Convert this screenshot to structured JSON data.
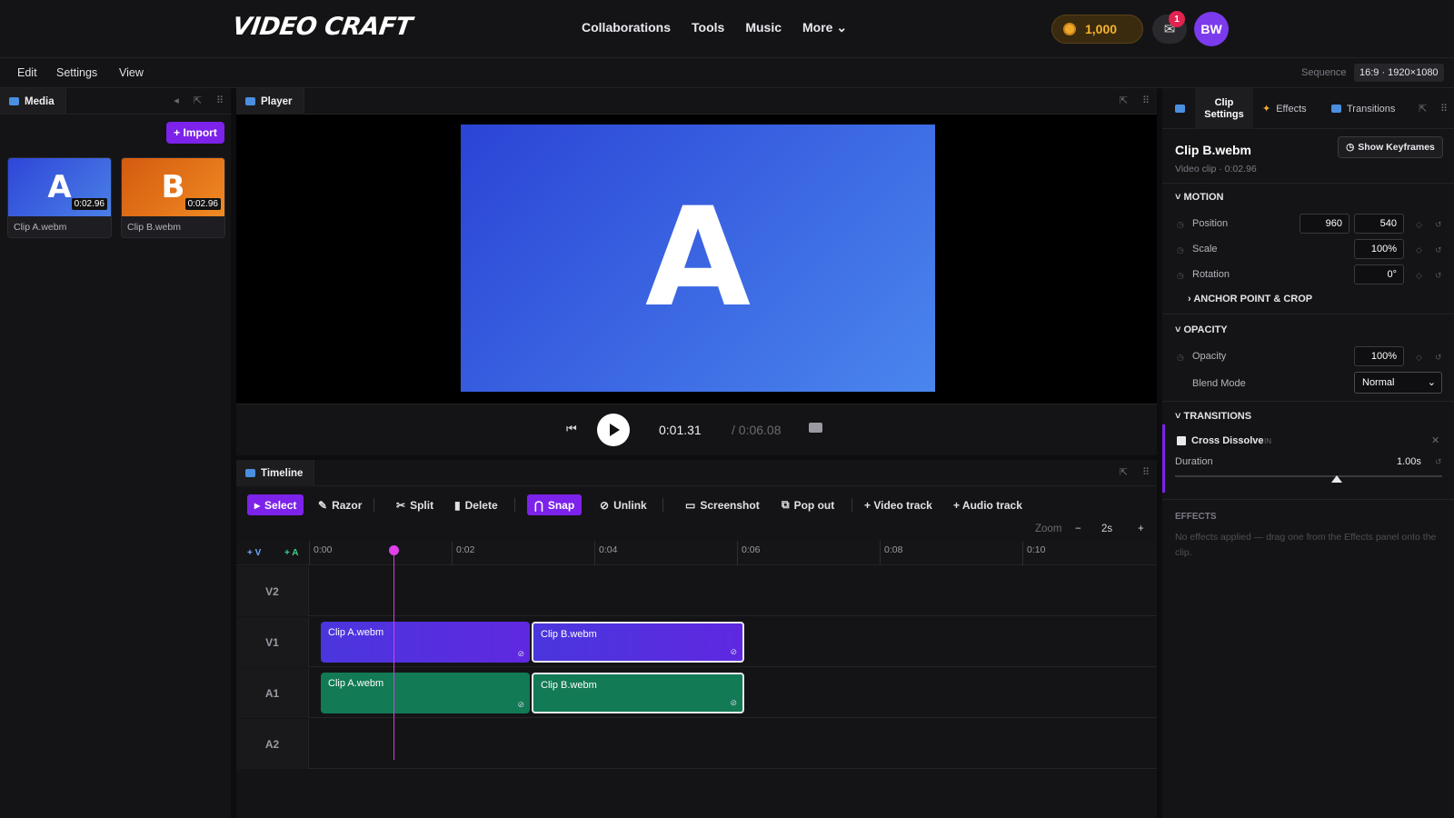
{
  "app": {
    "logo": "VIDEO CRAFT"
  },
  "nav": {
    "links": [
      "Collaborations",
      "Tools",
      "Music",
      "More ⌄"
    ]
  },
  "account": {
    "coins": "1,000",
    "inbox_badge": "1",
    "avatar": "BW"
  },
  "menubar": {
    "items": [
      "Edit",
      "Settings",
      "View"
    ],
    "sequence_label": "Sequence",
    "sequence_value": "16:9 · 1920×1080"
  },
  "media": {
    "title": "Media",
    "import_label": "+ Import",
    "clips": [
      {
        "letter": "A",
        "duration": "0:02.96",
        "name": "Clip A.webm"
      },
      {
        "letter": "B",
        "duration": "0:02.96",
        "name": "Clip B.webm"
      }
    ]
  },
  "player": {
    "title": "Player",
    "frame_letter": "A",
    "current_time": "0:01.31",
    "total_time": "/ 0:06.08"
  },
  "timeline": {
    "title": "Timeline",
    "tools": {
      "select": "Select",
      "razor": "Razor",
      "split": "Split",
      "delete": "Delete",
      "snap": "Snap",
      "unlink": "Unlink",
      "screenshot": "Screenshot",
      "popout": "Pop out",
      "video_track": "+ Video track",
      "audio_track": "+ Audio track"
    },
    "zoom": {
      "label": "Zoom",
      "minus": "−",
      "value": "2s",
      "plus": "+"
    },
    "add_v": "+ V",
    "add_a": "+ A",
    "ticks": [
      "0:00",
      "0:02",
      "0:04",
      "0:06",
      "0:08",
      "0:10"
    ],
    "tracks": [
      "V2",
      "V1",
      "A1",
      "A2"
    ],
    "clips": {
      "v1a": "Clip A.webm",
      "v1b": "Clip B.webm",
      "a1a": "Clip A.webm",
      "a1b": "Clip B.webm"
    }
  },
  "inspector": {
    "tabs": {
      "clip_settings_1": "Clip",
      "clip_settings_2": "Settings",
      "effects": "Effects",
      "transitions": "Transitions"
    },
    "clip_name": "Clip B.webm",
    "clip_meta": "Video clip · 0:02.96",
    "show_keyframes": "Show Keyframes",
    "motion": {
      "title": "MOTION",
      "position": "Position",
      "pos_x": "960",
      "pos_y": "540",
      "scale": "Scale",
      "scale_val": "100%",
      "rotation": "Rotation",
      "rotation_val": "0°",
      "anchor": "ANCHOR POINT & CROP"
    },
    "opacity": {
      "title": "OPACITY",
      "opacity": "Opacity",
      "opacity_val": "100%",
      "blend": "Blend Mode",
      "blend_val": "Normal"
    },
    "transitions": {
      "title": "TRANSITIONS",
      "name": "Cross Dissolve",
      "tag": "IN",
      "duration_label": "Duration",
      "duration_val": "1.00s"
    },
    "effects": {
      "title": "EFFECTS",
      "empty": "No effects applied — drag one from the Effects panel onto the clip."
    }
  }
}
